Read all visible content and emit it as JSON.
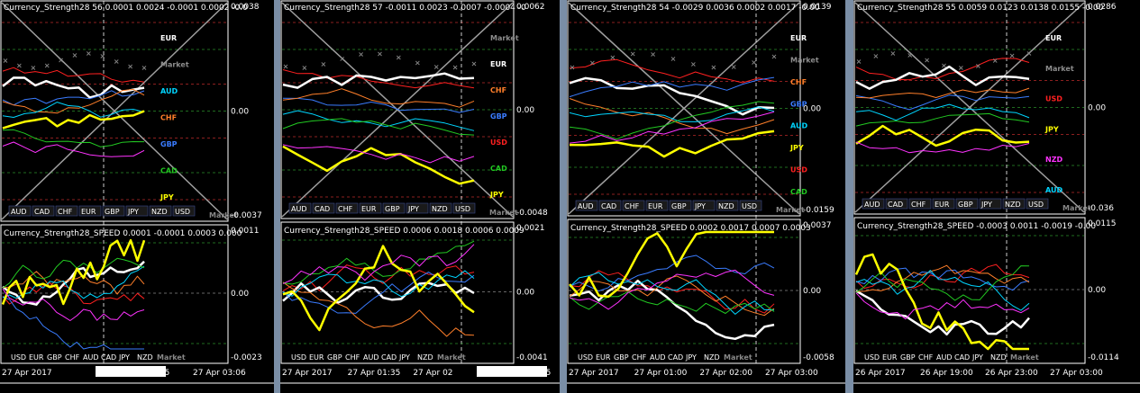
{
  "colors": {
    "USD": "#ff2020",
    "EUR": "#ffffff",
    "GBP": "#3a7cff",
    "CHF": "#ff7f2a",
    "AUD": "#00d5ff",
    "CAD": "#22c922",
    "JPY": "#ffff00",
    "NZD": "#ff33ff",
    "Market": "#8c8c8c",
    "background": "#000000",
    "frame": "#7a8ea6"
  },
  "legend_order_strength": [
    "AUD",
    "CAD",
    "CHF",
    "EUR",
    "GBP",
    "JPY",
    "NZD",
    "USD"
  ],
  "legend_order_speed": [
    "USD",
    "EUR",
    "GBP",
    "CHF",
    "AUD",
    "CAD",
    "JPY",
    "NZD"
  ],
  "market_label": "Market",
  "charts": [
    {
      "title": "Currency_Strength28 56 0.0001 0.0024 -0.0001 0.0002 -0.0",
      "axis": [
        "0.0038",
        "0.00",
        "-0.0037"
      ],
      "line_labels": [
        "EUR",
        "Market",
        "AUD",
        "CHF",
        "GBP",
        "CAD",
        "JPY"
      ],
      "speed_title": "Currency_Strength28_SPEED 0.0001 -0.0001 0.0003 0.000",
      "speed_axis": [
        "0.0011",
        "0.00",
        "-0.0023"
      ],
      "time_labels": [
        "27 Apr 2017",
        "2017.04.27 03:05",
        "27 Apr 03:06"
      ]
    },
    {
      "title": "Currency_Strength28 57 -0.0011 0.0023 -0.0007 -0.0004 -0",
      "axis": [
        "0.0062",
        "0.00",
        "-0.0048"
      ],
      "line_labels": [
        "Market",
        "EUR",
        "CHF",
        "GBP",
        "USD",
        "CAD",
        "JPY"
      ],
      "speed_title": "Currency_Strength28_SPEED 0.0006 0.0018 0.0006 0.0009",
      "speed_axis": [
        "0.0021",
        "0.00",
        "-0.0041"
      ],
      "time_labels": [
        "27 Apr 2017",
        "27 Apr 01:35",
        "27 Apr 02",
        "2017.04.27 03:05"
      ]
    },
    {
      "title": "Currency_Strength28 54 -0.0029 0.0036 0.0002 0.0017 -0.00",
      "axis": [
        "0.0139",
        "0.00",
        "-0.0159"
      ],
      "line_labels": [
        "EUR",
        "Market",
        "CHF",
        "GBP",
        "AUD",
        "JPY",
        "USD",
        "CAD"
      ],
      "speed_title": "Currency_Strength28_SPEED 0.0002 0.0017 0.0007 0.0003",
      "speed_axis": [
        "0.0037",
        "0.00",
        "-0.0058"
      ],
      "time_labels": [
        "27 Apr 2017",
        "27 Apr 01:00",
        "27 Apr 02:00",
        "27 Apr 03:00"
      ]
    },
    {
      "title": "Currency_Strength28 55 0.0059 0.0123 0.0138 0.0155 -0.00",
      "axis": [
        "0.0286",
        "0.00",
        "-0.036"
      ],
      "line_labels": [
        "EUR",
        "Market",
        "USD",
        "JPY",
        "NZD",
        "AUD"
      ],
      "speed_title": "Currency_Strength28_SPEED -0.0003 0.0011 -0.0019 -0.00",
      "speed_axis": [
        "0.0115",
        "0.00",
        "-0.0114"
      ],
      "time_labels": [
        "26 Apr 2017",
        "26 Apr 19:00",
        "26 Apr 23:00",
        "27 Apr 03:00"
      ]
    }
  ]
}
